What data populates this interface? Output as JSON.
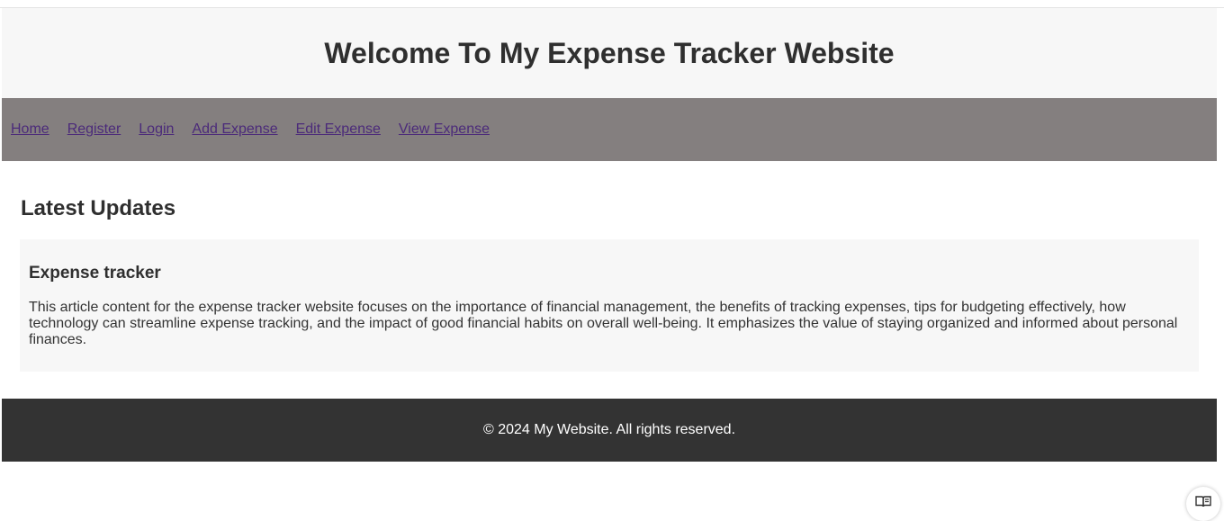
{
  "header": {
    "title": "Welcome To My Expense Tracker Website"
  },
  "nav": {
    "links": [
      {
        "label": "Home"
      },
      {
        "label": "Register"
      },
      {
        "label": "Login"
      },
      {
        "label": "Add Expense"
      },
      {
        "label": "Edit Expense"
      },
      {
        "label": "View Expense"
      }
    ],
    "link_color": "#4b2a7a",
    "background": "#847f7f"
  },
  "main": {
    "section_title": "Latest Updates",
    "article": {
      "title": "Expense tracker",
      "body": "This article content for the expense tracker website focuses on the importance of financial management, the benefits of tracking expenses, tips for budgeting effectively, how technology can streamline expense tracking, and the impact of good financial habits on overall well-being. It emphasizes the value of staying organized and informed about personal finances."
    }
  },
  "footer": {
    "text": "© 2024 My Website. All rights reserved.",
    "background": "#333333"
  },
  "reader_button": {
    "icon": "reader-mode-icon"
  }
}
